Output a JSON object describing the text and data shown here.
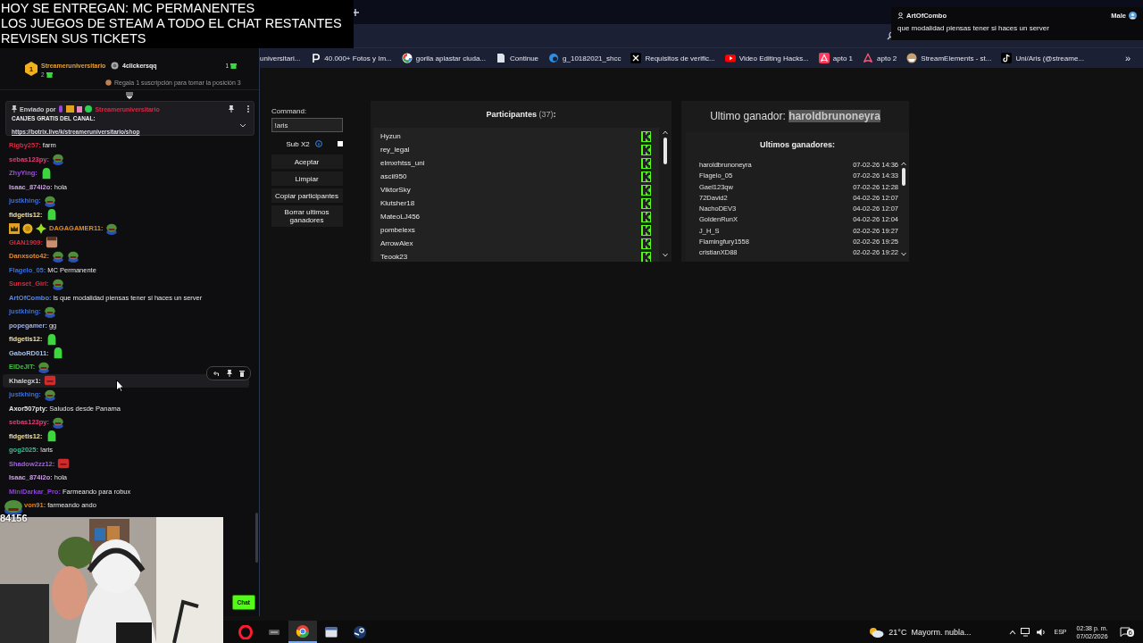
{
  "stream_overlay": {
    "lines": [
      "HOY SE ENTREGAN: MC PERMANENTES",
      "LOS JUEGOS DE STEAM A TODO EL CHAT RESTANTES",
      "REVISEN SUS TICKETS"
    ]
  },
  "notification": {
    "user": "ArtOfCombo",
    "gender": "Male",
    "message": "que modalidad piensas tener si haces un server"
  },
  "browser": {
    "bookmarks": [
      {
        "label": "universitari..."
      },
      {
        "label": "40.000+ Fotos y Im..."
      },
      {
        "label": "gorila aplastar ciuda..."
      },
      {
        "label": "Continue"
      },
      {
        "label": "g_10182021_shcc"
      },
      {
        "label": "Requisitos de verific..."
      },
      {
        "label": "Video Editing Hacks..."
      },
      {
        "label": "apto 1"
      },
      {
        "label": "apto 2"
      },
      {
        "label": "StreamElements - st..."
      },
      {
        "label": "Uni/Aris (@streame..."
      }
    ],
    "bookmarks_overflow": "»"
  },
  "chat": {
    "leaders": [
      {
        "rank": "1",
        "name": "Streameruniversitario",
        "count": "2"
      },
      {
        "name": "4clickersqq",
        "count": "1"
      }
    ],
    "leader_hint": "Regala 1 suscripción para tomar la posición 3",
    "pinned": {
      "sender_label": "Enviado por",
      "sender": "Streameruniversitario",
      "title": "CANJES GRATIS DEL CANAL:",
      "link": "https://botrix.live/k/streameruniversitario/shop"
    },
    "messages": [
      {
        "user": "Rigby257:",
        "color": "#d42a44",
        "kind": "text",
        "text": "farm"
      },
      {
        "user": "sebas123py:",
        "color": "#e0407a",
        "kind": "frog"
      },
      {
        "user": "ZhyYing:",
        "color": "#9b4de0",
        "kind": "blob"
      },
      {
        "user": "Isaac_874i2o:",
        "color": "#c9a0e0",
        "kind": "text",
        "text": "hola"
      },
      {
        "user": "justkhing:",
        "color": "#3a6fd8",
        "kind": "frog"
      },
      {
        "user": "fidgetis12:",
        "color": "#f0e0a0",
        "kind": "blob"
      },
      {
        "user": "DAGAGAMER11:",
        "color": "#e08a20",
        "kind": "frog",
        "badges": true
      },
      {
        "user": "GIAN1909:",
        "color": "#d42a44",
        "kind": "face"
      },
      {
        "user": "Danxsoto42:",
        "color": "#e08a30",
        "kind": "frogs"
      },
      {
        "user": "Flagelo_05:",
        "color": "#3a6fd8",
        "kind": "text",
        "text": "MC Permanente"
      },
      {
        "user": "Sunset_Girl:",
        "color": "#d42a44",
        "kind": "frog"
      },
      {
        "user": "ArtOfCombo:",
        "color": "#5a8ae0",
        "kind": "text",
        "text": "ls que modalidad piensas tener si haces un server"
      },
      {
        "user": "justkhing:",
        "color": "#3a6fd8",
        "kind": "frog"
      },
      {
        "user": "popegamer:",
        "color": "#a0b0e0",
        "kind": "text",
        "text": "gg"
      },
      {
        "user": "fidgetis12:",
        "color": "#f0e0a0",
        "kind": "blob"
      },
      {
        "user": "GaboRD011:",
        "color": "#a0c0f0",
        "kind": "blob"
      },
      {
        "user": "ElDeJIT:",
        "color": "#40c040",
        "kind": "frog"
      },
      {
        "user": "Khalegx1:",
        "color": "#d0d0d0",
        "kind": "red",
        "hovered": true
      },
      {
        "user": "justkhing:",
        "color": "#3a6fd8",
        "kind": "frog"
      },
      {
        "user": "Axor507pty:",
        "color": "#e6e6e6",
        "kind": "text",
        "text": "Saludos desde Panama"
      },
      {
        "user": "sebas123py:",
        "color": "#e0407a",
        "kind": "frog"
      },
      {
        "user": "fidgetis12:",
        "color": "#f0e0a0",
        "kind": "blob"
      },
      {
        "user": "gog2025:",
        "color": "#30c090",
        "kind": "text",
        "text": "!aris"
      },
      {
        "user": "Shadow2zz12:",
        "color": "#a060e0",
        "kind": "red"
      },
      {
        "user": "Isaac_874i2o:",
        "color": "#c9a0e0",
        "kind": "text",
        "text": "hola"
      },
      {
        "user": "MiniDarkar_Pro:",
        "color": "#9040e0",
        "kind": "text",
        "text": "Farmeando para robux"
      },
      {
        "user": "von91:",
        "color": "#e08020",
        "kind": "text",
        "text": "farmeando ando"
      }
    ],
    "overlay_count": "84156",
    "chat_button": "Chat"
  },
  "giveaway": {
    "command_label": "Command:",
    "command_value": "!aris",
    "sub_option": {
      "label": "Sub X2",
      "checked": false
    },
    "buttons": [
      "Aceptar",
      "Limpiar",
      "Copiar participantes",
      "Borrar ultimos ganadores"
    ],
    "participants_title": "Participantes",
    "participants_count": "(37)",
    "participants_suffix": ":",
    "participants": [
      {
        "name": "Hyzun",
        "kind": "kick"
      },
      {
        "name": "rey_legal",
        "kind": "kick"
      },
      {
        "name": "elmxrhtss_uni",
        "kind": "kick"
      },
      {
        "name": "ascii950",
        "kind": "kick"
      },
      {
        "name": "ViktorSky",
        "kind": "kick"
      },
      {
        "name": "Klutsher18",
        "kind": "kick"
      },
      {
        "name": "MateoLJ456",
        "kind": "kick"
      },
      {
        "name": "pombelexs",
        "kind": "kick"
      },
      {
        "name": "ArrowAlex",
        "kind": "kick"
      },
      {
        "name": "Teook23",
        "kind": "kick"
      }
    ],
    "last_winner_label": "Ultimo ganador:",
    "last_winner": "haroldbrunoneyra",
    "winners_title": "Ultimos ganadores:",
    "winners": [
      {
        "name": "haroldbrunoneyra",
        "date": "07-02-26 14:36"
      },
      {
        "name": "Flagelo_05",
        "date": "07-02-26 14:33"
      },
      {
        "name": "Gael123qw",
        "date": "07-02-26 12:28"
      },
      {
        "name": "72David2",
        "date": "04-02-26 12:07"
      },
      {
        "name": "NachoDEV3",
        "date": "04-02-26 12:07"
      },
      {
        "name": "GoldenRunX",
        "date": "04-02-26 12:04"
      },
      {
        "name": "J_H_S",
        "date": "02-02-26 19:27"
      },
      {
        "name": "Flamingfury1558",
        "date": "02-02-26 19:25"
      },
      {
        "name": "cristianXD88",
        "date": "02-02-26 19:22"
      }
    ]
  },
  "taskbar": {
    "apps": [
      {
        "kind": "opera",
        "active": false
      },
      {
        "kind": "game",
        "active": false
      },
      {
        "kind": "chrome",
        "active": true
      },
      {
        "kind": "window",
        "active": false
      },
      {
        "kind": "steam",
        "active": false
      }
    ],
    "temperature": "21°C",
    "weather": "Mayorm. nubla...",
    "language": "ESP",
    "time": "02:38 p. m.",
    "date": "07/02/2026",
    "notifications": "6"
  }
}
